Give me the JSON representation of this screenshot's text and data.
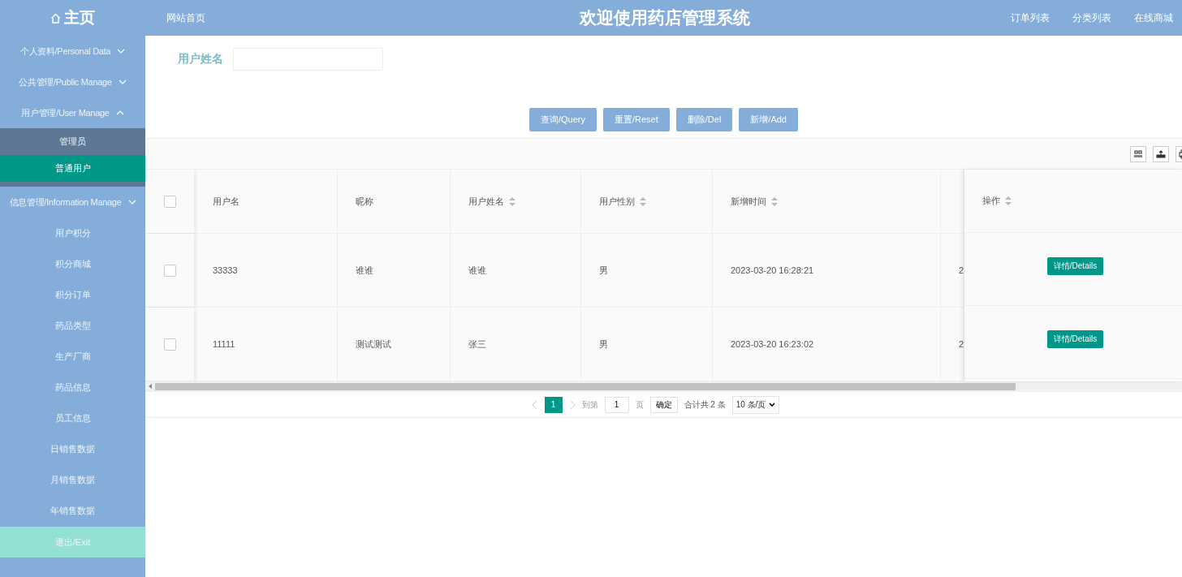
{
  "header": {
    "home": "主页",
    "nav": "网站首页",
    "title": "欢迎使用药店管理系统",
    "links": [
      "订单列表",
      "分类列表",
      "在线商城"
    ]
  },
  "sidebar": {
    "groups": [
      {
        "label": "个人资料/Personal Data",
        "expanded": false
      },
      {
        "label": "公共管理/Public Manage",
        "expanded": false
      },
      {
        "label": "用户管理/User Manage",
        "expanded": true,
        "children": [
          {
            "label": "管理员",
            "selected": false
          },
          {
            "label": "普通用户",
            "selected": true
          }
        ]
      },
      {
        "label": "信息管理/Information Manage",
        "expanded": false,
        "children": [
          {
            "label": "用户积分",
            "selected": false
          },
          {
            "label": "积分商城",
            "selected": false
          },
          {
            "label": "积分订单",
            "selected": false
          },
          {
            "label": "药品类型",
            "selected": false
          },
          {
            "label": "生产厂商",
            "selected": false
          },
          {
            "label": "药品信息",
            "selected": false
          },
          {
            "label": "员工信息",
            "selected": false
          },
          {
            "label": "日销售数据",
            "selected": false
          },
          {
            "label": "月销售数据",
            "selected": false
          },
          {
            "label": "年销售数据",
            "selected": false
          }
        ]
      }
    ],
    "exit": "退出/Exit"
  },
  "search": {
    "label": "用户姓名"
  },
  "buttons": [
    "查询/Query",
    "重置/Reset",
    "删除/Del",
    "新增/Add"
  ],
  "toolbar": [
    {
      "kind": "columns"
    },
    {
      "kind": "export"
    },
    {
      "kind": "print"
    }
  ],
  "table": {
    "select_all": {
      "checked": false
    },
    "columns": [
      {
        "label": "用户名",
        "sortable": false
      },
      {
        "label": "昵称",
        "sortable": false
      },
      {
        "label": "用户姓名",
        "sortable": true
      },
      {
        "label": "用户性别",
        "sortable": true
      },
      {
        "label": "新增时间",
        "sortable": true
      }
    ],
    "action_column": {
      "label": "操作",
      "sortable": true
    },
    "rows": [
      {
        "checked": false,
        "cells": [
          "33333",
          "谁谁",
          "谁谁",
          "男",
          "2023-03-20 16:28:21",
          "2"
        ],
        "action": "详情/Details"
      },
      {
        "checked": false,
        "cells": [
          "11111",
          "测试测试",
          "张三",
          "男",
          "2023-03-20 16:23:02",
          "2"
        ],
        "action": "详情/Details"
      }
    ]
  },
  "pagination": {
    "pages": [
      {
        "label": "1",
        "selected": true
      }
    ],
    "goto_label": "到第",
    "goto_value": "1",
    "page_unit": "页",
    "confirm": "确定",
    "total": "合计共 2 条",
    "page_size": "10 条/页"
  }
}
